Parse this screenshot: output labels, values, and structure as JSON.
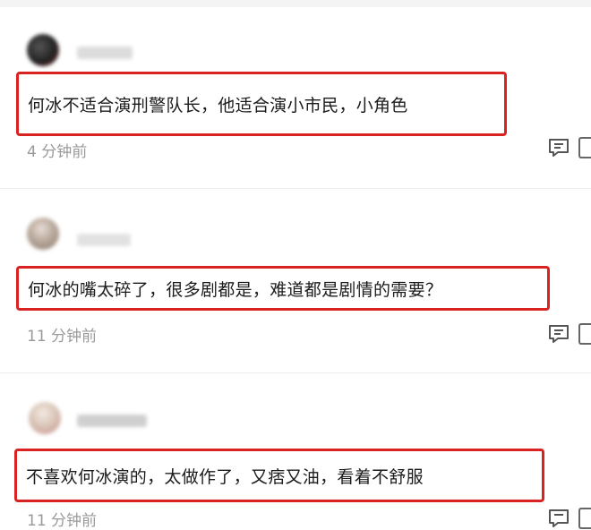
{
  "comments": [
    {
      "text": "何冰不适合演刑警队长，他适合演小市民，小角色",
      "time": "4 分钟前"
    },
    {
      "text": "何冰的嘴太碎了，很多剧都是，难道都是剧情的需要？",
      "time": "11 分钟前"
    },
    {
      "text": "不喜欢何冰演的，太做作了，又痞又油，看着不舒服",
      "time": "11 分钟前"
    }
  ],
  "colors": {
    "highlight_border": "#d92222",
    "time_text": "#9a9a9a"
  },
  "icons": {
    "reply": "comment-reply-icon",
    "more": "more-icon"
  }
}
